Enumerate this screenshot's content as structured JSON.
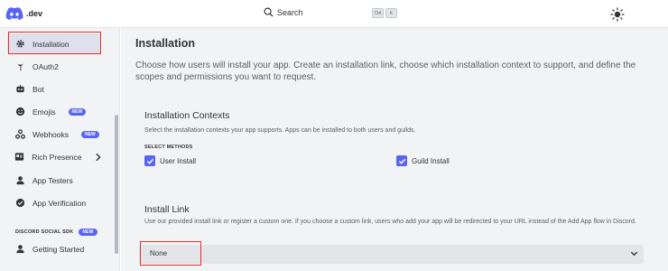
{
  "header": {
    "logo_text": ".dev",
    "search_label": "Search",
    "shortcut_keys": [
      "Ctrl",
      "K"
    ]
  },
  "sidebar": {
    "items": [
      {
        "label": "Installation",
        "icon": "gear-icon",
        "active": true
      },
      {
        "label": "OAuth2",
        "icon": "wrench-icon"
      },
      {
        "label": "Bot",
        "icon": "bot-icon"
      },
      {
        "label": "Emojis",
        "icon": "smile-icon",
        "badge": "NEW"
      },
      {
        "label": "Webhooks",
        "icon": "webhook-icon",
        "badge": "NEW"
      },
      {
        "label": "Rich Presence",
        "icon": "presence-icon",
        "has_submenu": true
      },
      {
        "label": "App Testers",
        "icon": "user-icon"
      },
      {
        "label": "App Verification",
        "icon": "check-badge-icon"
      },
      {
        "label": "Getting Started",
        "icon": "user-icon"
      }
    ],
    "section_header": "DISCORD SOCIAL SDK",
    "section_badge": "NEW"
  },
  "main": {
    "title": "Installation",
    "description": "Choose how users will install your app. Create an installation link, choose which installation context to support, and define the scopes and permissions you want to request.",
    "contexts": {
      "title": "Installation Contexts",
      "description": "Select the installation contexts your app supports. Apps can be installed to both users and guilds.",
      "methods_label": "SELECT METHODS",
      "options": [
        {
          "label": "User Install",
          "checked": true
        },
        {
          "label": "Guild Install",
          "checked": true
        }
      ]
    },
    "install_link": {
      "title": "Install Link",
      "description": "Use our provided install link or register a custom one. If you choose a custom link, users who add your app will be redirected to your URL instead of the Add App flow in Discord.",
      "selected": "None"
    }
  },
  "colors": {
    "accent": "#5865f2",
    "highlight_box": "#e0342c",
    "sidebar_bg": "#f2f3f5",
    "active_item_bg": "#dfe0ed"
  }
}
